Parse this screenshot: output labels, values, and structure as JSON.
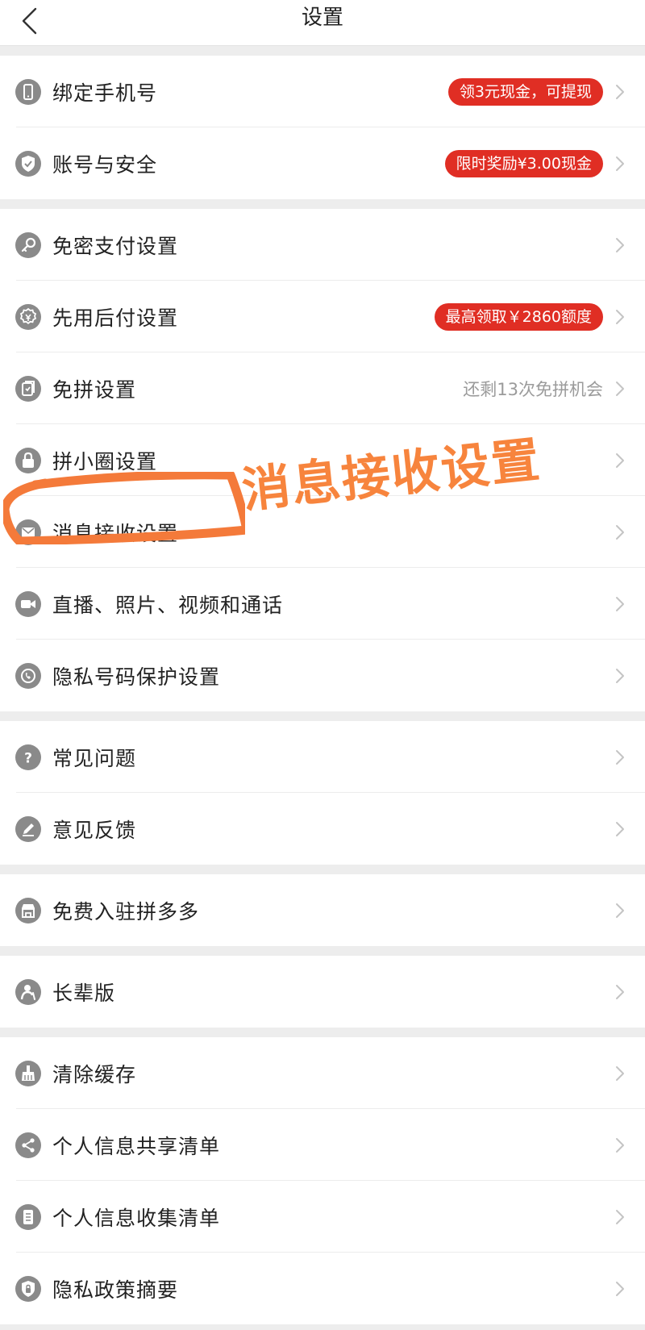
{
  "header": {
    "title": "设置"
  },
  "groups": [
    [
      {
        "label": "绑定手机号",
        "icon": "phone-icon",
        "badge": "领3元现金，可提现"
      },
      {
        "label": "账号与安全",
        "icon": "shield-check-icon",
        "badge": "限时奖励¥3.00现金"
      }
    ],
    [
      {
        "label": "免密支付设置",
        "icon": "key-icon"
      },
      {
        "label": "先用后付设置",
        "icon": "pay-later-icon",
        "badge": "最高领取￥2860额度"
      },
      {
        "label": "免拼设置",
        "icon": "group-card-icon",
        "hint": "还剩13次免拼机会"
      },
      {
        "label": "拼小圈设置",
        "icon": "lock-icon"
      },
      {
        "label": "消息接收设置",
        "icon": "envelope-icon"
      },
      {
        "label": "直播、照片、视频和通话",
        "icon": "video-camera-icon"
      },
      {
        "label": "隐私号码保护设置",
        "icon": "phone-shield-icon"
      }
    ],
    [
      {
        "label": "常见问题",
        "icon": "question-icon"
      },
      {
        "label": "意见反馈",
        "icon": "pencil-icon"
      }
    ],
    [
      {
        "label": "免费入驻拼多多",
        "icon": "store-icon"
      }
    ],
    [
      {
        "label": "长辈版",
        "icon": "elder-icon"
      }
    ],
    [
      {
        "label": "清除缓存",
        "icon": "broom-icon"
      },
      {
        "label": "个人信息共享清单",
        "icon": "share-icon"
      },
      {
        "label": "个人信息收集清单",
        "icon": "document-list-icon"
      },
      {
        "label": "隐私政策摘要",
        "icon": "lock-shield-icon"
      }
    ]
  ],
  "annotation": {
    "text": "消息接收设置"
  },
  "colors": {
    "badge": "#e02e24",
    "icon": "#8a8a8a",
    "annotation": "#f7843d"
  }
}
